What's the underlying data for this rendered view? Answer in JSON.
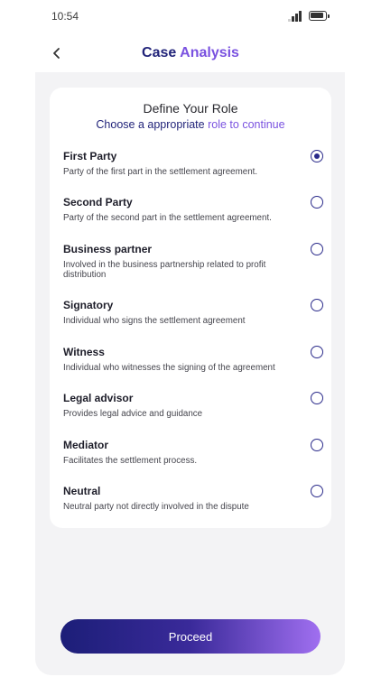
{
  "status_bar": {
    "time": "10:54",
    "signal_icon": "cellular-signal-icon",
    "battery_icon": "battery-icon"
  },
  "header": {
    "title_part1": "Case",
    "title_part2": "Analysis",
    "back_icon": "chevron-left-icon"
  },
  "card": {
    "title": "Define Your Role",
    "subtitle_part1": "Choose a appropriate",
    "subtitle_part2": "role to continue",
    "roles": [
      {
        "name": "First Party",
        "description": "Party of the first part in the settlement agreement.",
        "selected": true
      },
      {
        "name": "Second Party",
        "description": "Party of the second part in the settlement agreement.",
        "selected": false
      },
      {
        "name": "Business partner",
        "description": "Involved in the business partnership related to profit distribution",
        "selected": false
      },
      {
        "name": "Signatory",
        "description": "Individual who signs the settlement agreement",
        "selected": false
      },
      {
        "name": "Witness",
        "description": "Individual who witnesses the signing of the agreement",
        "selected": false
      },
      {
        "name": "Legal advisor",
        "description": "Provides legal advice and guidance",
        "selected": false
      },
      {
        "name": "Mediator",
        "description": "Facilitates the settlement process.",
        "selected": false
      },
      {
        "name": "Neutral",
        "description": "Neutral party not directly involved in the dispute",
        "selected": false
      }
    ]
  },
  "proceed_label": "Proceed",
  "colors": {
    "primary": "#22247a",
    "accent": "#7a52e0",
    "panel_bg": "#f3f3f5"
  }
}
